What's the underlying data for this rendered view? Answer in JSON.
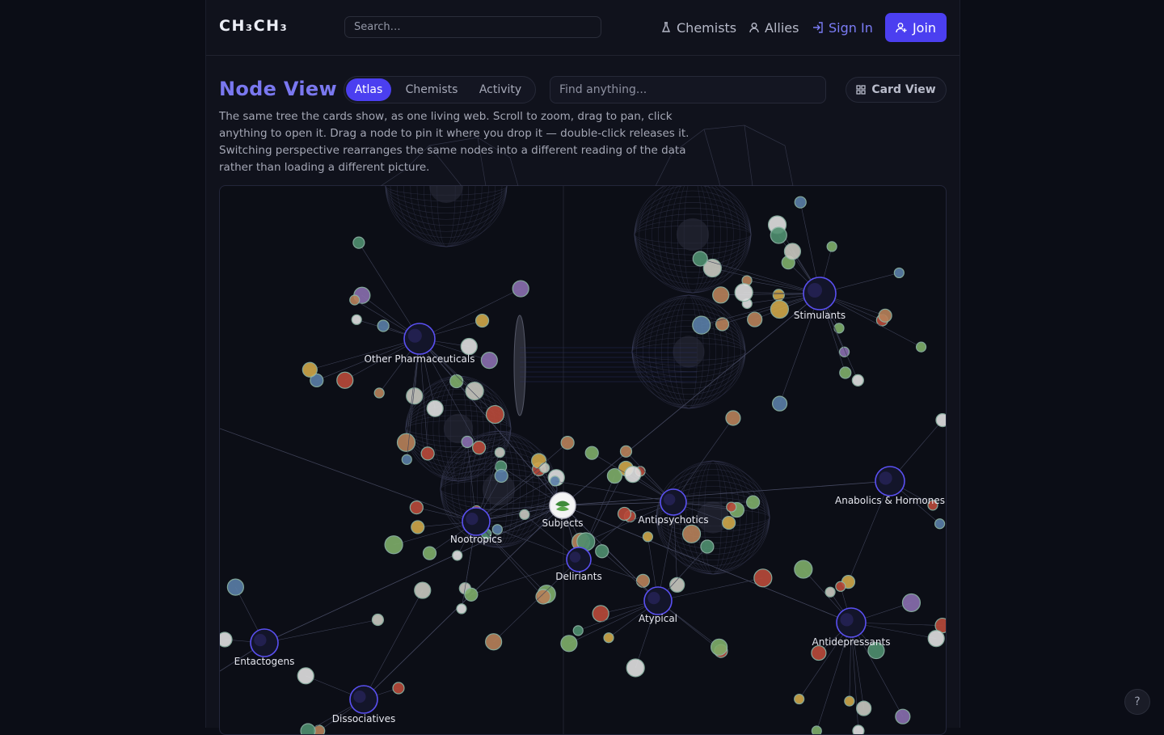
{
  "brand": {
    "logo": "CH₃CH₃"
  },
  "header": {
    "search_placeholder": "Search…",
    "nav": [
      {
        "label": "Chemists",
        "icon": "flask-icon"
      },
      {
        "label": "Allies",
        "icon": "user-icon"
      },
      {
        "label": "Sign In",
        "icon": "sign-in-icon"
      }
    ],
    "join_label": "Join"
  },
  "main": {
    "title": "Node View",
    "tabs": [
      {
        "label": "Atlas",
        "active": true
      },
      {
        "label": "Chemists",
        "active": false
      },
      {
        "label": "Activity",
        "active": false
      }
    ],
    "find_placeholder": "Find anything...",
    "card_view_label": "Card View",
    "description": "The same tree the cards show, as one living web. Scroll to zoom, drag to pan, click anything to open it. Drag a node to pin it where you drop it — double-click releases it. Switching perspective rearranges the same nodes into a different reading of the data rather than loading a different picture."
  },
  "graph": {
    "categories": [
      "Subjects",
      "Other Pharmaceuticals",
      "Stimulants",
      "Nootropics",
      "Deliriants",
      "Antipsychotics",
      "Anabolics & Hormones",
      "Atypical",
      "Antidepressants",
      "Entactogens",
      "Dissociatives"
    ]
  },
  "colors": {
    "accent": "#4b3ff0",
    "accent_text": "#7a78f0",
    "background": "#10121c",
    "category_ring": "#5a50f2",
    "leaf_ring": "#8fb8a8"
  },
  "help_label": "?"
}
